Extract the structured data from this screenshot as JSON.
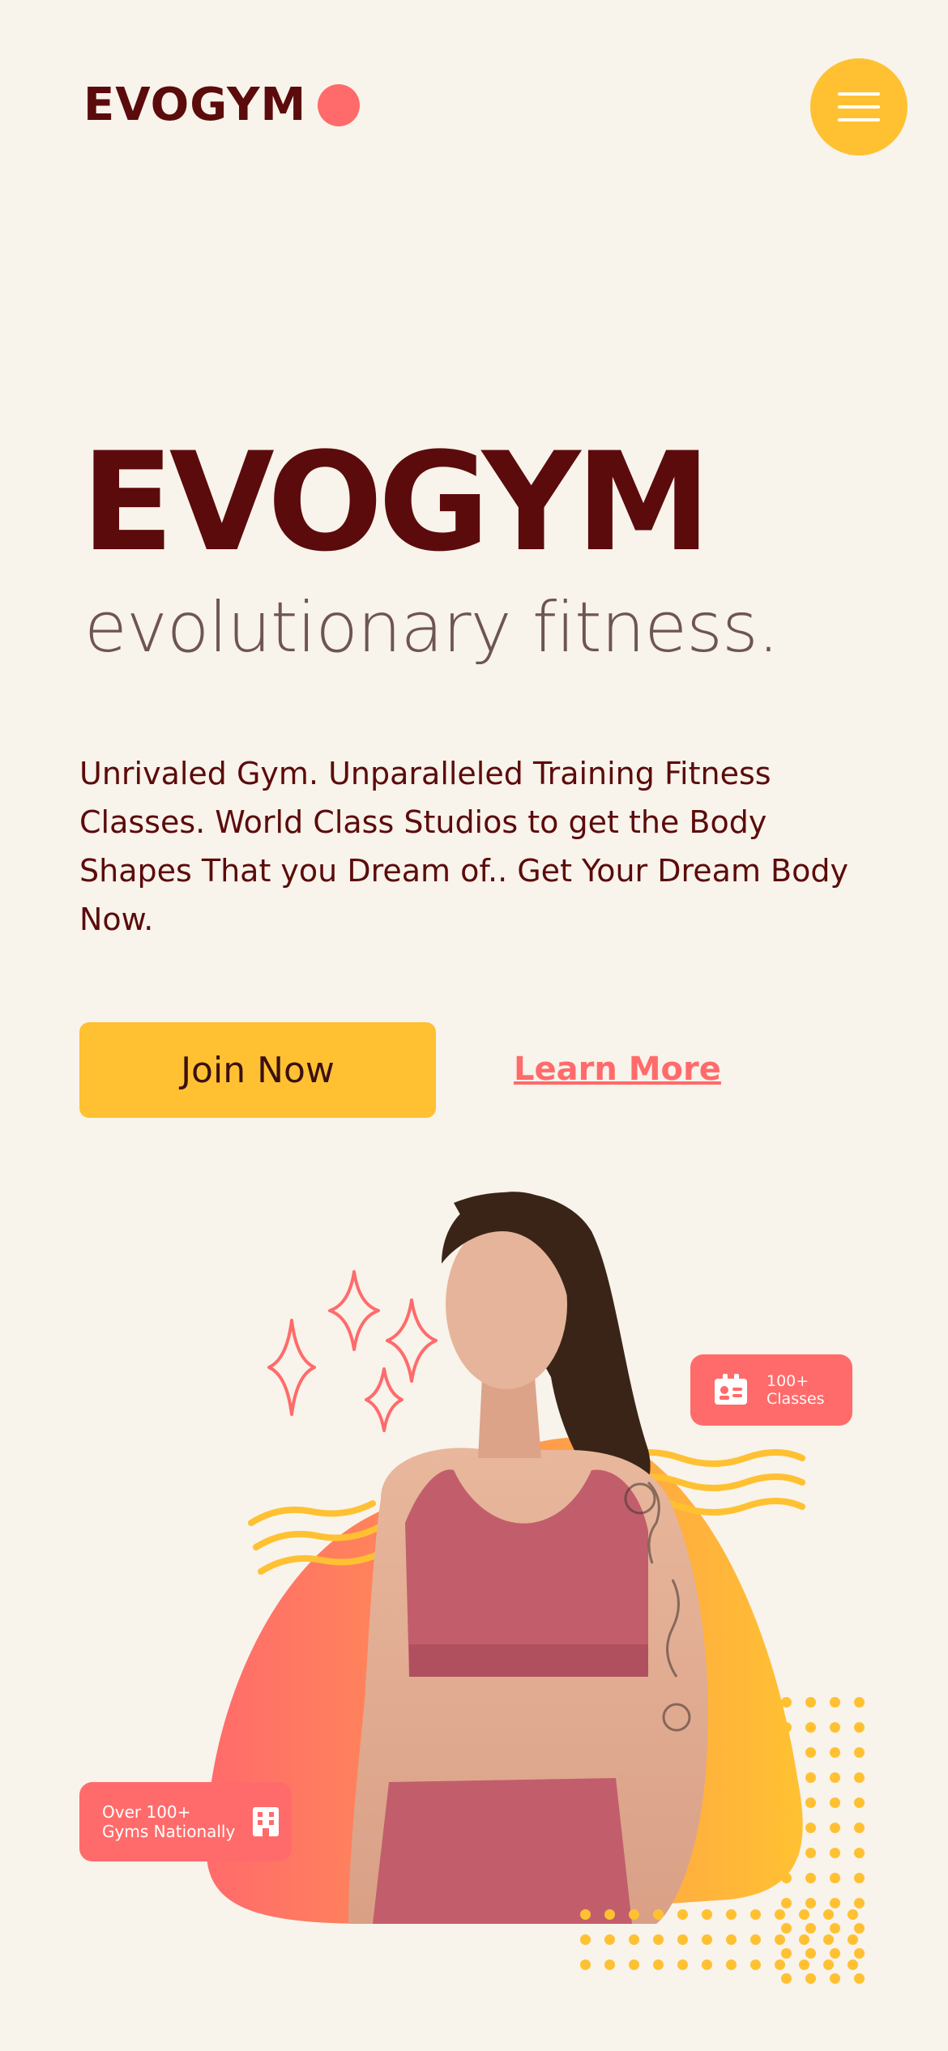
{
  "header": {
    "logo_text": "EVOGYM",
    "menu_icon": "hamburger-menu-icon"
  },
  "hero": {
    "title": "EVOGYM",
    "subtitle": "evolutionary fitness.",
    "description": "Unrivaled Gym. Unparalleled Training Fitness Classes. World Class Studios to get the Body Shapes That you Dream of.. Get Your Dream Body Now.",
    "join_label": "Join Now",
    "learn_more_label": "Learn More"
  },
  "badges": {
    "classes": {
      "line1": "100+",
      "line2": "Classes",
      "icon": "id-card-icon"
    },
    "gyms": {
      "line1": "Over 100+",
      "line2": "Gyms Nationally",
      "icon": "building-icon"
    }
  },
  "colors": {
    "background": "#f8f3eb",
    "brand_dark": "#5b0b0b",
    "accent_yellow": "#ffc132",
    "accent_coral": "#ff6b6b"
  }
}
